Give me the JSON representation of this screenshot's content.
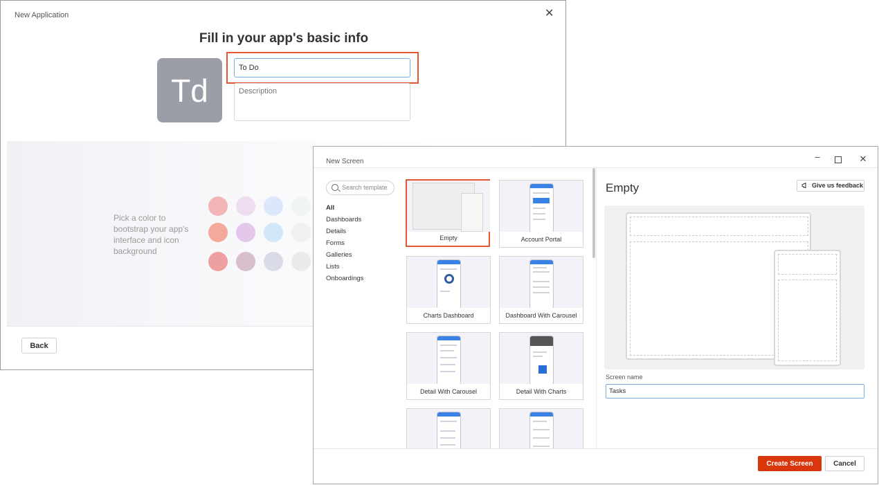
{
  "new_application": {
    "title": "New Application",
    "heading": "Fill in your app's basic info",
    "avatar_initials": "Td",
    "name_value": "To Do",
    "description_placeholder": "Description",
    "color_hint": "Pick a color to bootstrap your app's interface and icon background",
    "back_label": "Back",
    "swatch_colors": [
      "#f2b6b6",
      "#eedcf1",
      "#dbe8fb",
      "#f0f4f2",
      "#f4a99c",
      "#e3c8ec",
      "#d2e8f8",
      "#eef1f0",
      "#ee9f9f",
      "#d7bfcc",
      "#d9dce6",
      "#eaeaea"
    ],
    "highlight_color": "#e4572e"
  },
  "new_screen": {
    "title": "New Screen",
    "search_placeholder": "Search template",
    "categories": [
      "All",
      "Dashboards",
      "Details",
      "Forms",
      "Galleries",
      "Lists",
      "Onboardings"
    ],
    "active_category": "All",
    "templates": [
      "Empty",
      "Account Portal",
      "Charts Dashboard",
      "Dashboard With Carousel",
      "Detail With Carousel",
      "Detail With Charts",
      "",
      ""
    ],
    "selected_template": "Empty",
    "preview_title": "Empty",
    "feedback_label": "Give us feedback",
    "screen_name_label": "Screen name",
    "screen_name_value": "Tasks",
    "create_label": "Create Screen",
    "cancel_label": "Cancel",
    "accent_color": "#d9360b"
  }
}
